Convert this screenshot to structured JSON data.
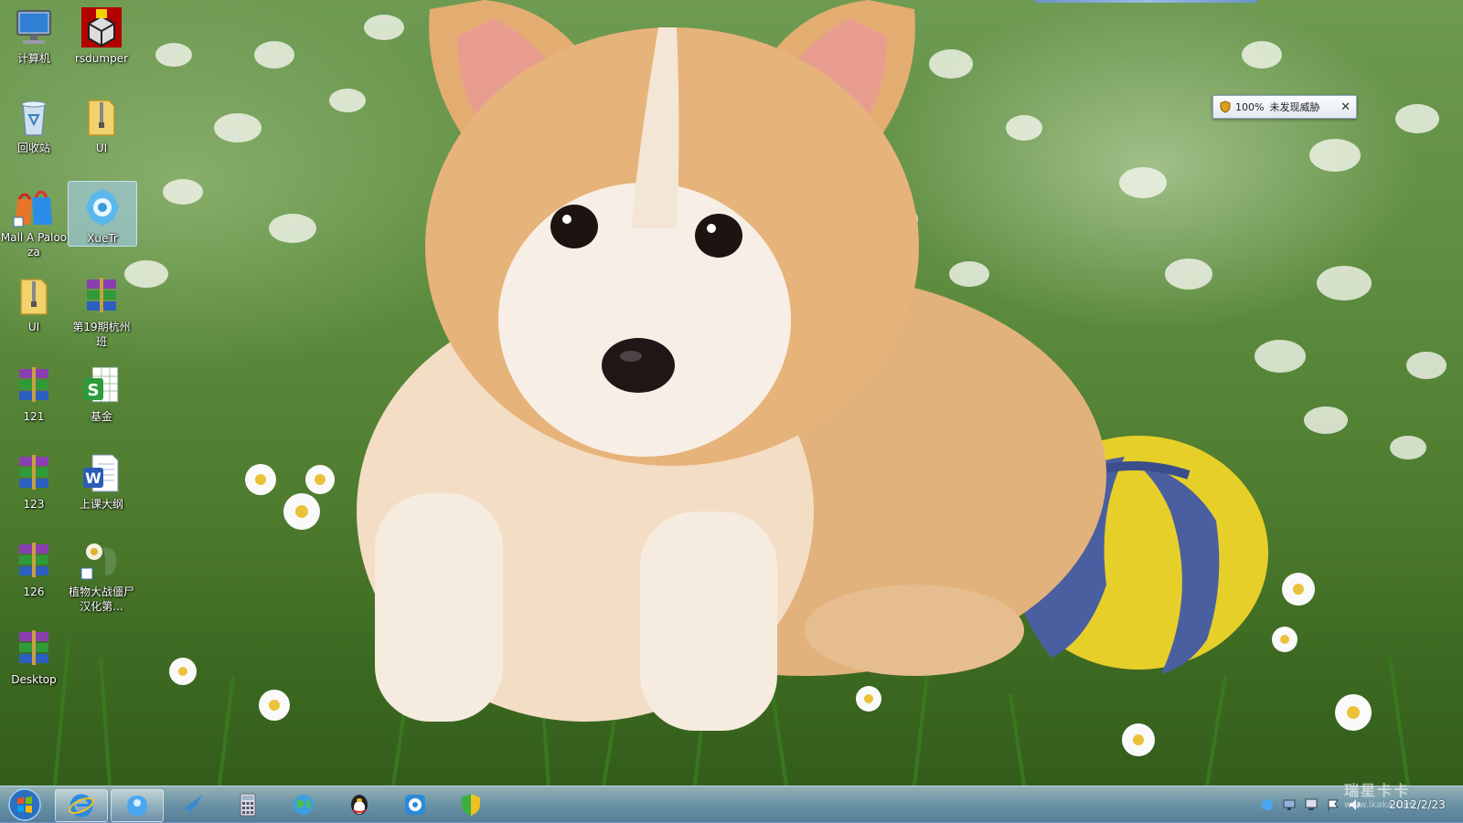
{
  "desktop": {
    "icons": [
      {
        "label": "计算机",
        "icon": "computer-icon"
      },
      {
        "label": "rsdumper",
        "icon": "rsdumper-icon"
      },
      {
        "label": "回收站",
        "icon": "recycle-bin-icon"
      },
      {
        "label": "UI",
        "icon": "zip-folder-icon"
      },
      {
        "label": "Mall A Palooza",
        "icon": "shopping-bag-icon"
      },
      {
        "label": "XueTr",
        "icon": "gear-icon"
      },
      {
        "label": "UI",
        "icon": "zip-folder-icon"
      },
      {
        "label": "第19期杭州班",
        "icon": "winrar-archive-icon"
      },
      {
        "label": "121",
        "icon": "winrar-archive-icon"
      },
      {
        "label": "基金",
        "icon": "spreadsheet-icon"
      },
      {
        "label": "123",
        "icon": "winrar-archive-icon"
      },
      {
        "label": "上课大纲",
        "icon": "word-document-icon"
      },
      {
        "label": "126",
        "icon": "winrar-archive-icon"
      },
      {
        "label": "植物大战僵尸 汉化第...",
        "icon": "plants-vs-zombies-icon"
      },
      {
        "label": "Desktop",
        "icon": "winrar-archive-icon"
      }
    ],
    "selected_label": "XueTr"
  },
  "antivirus_popup": {
    "percent": "100%",
    "status": "未发现威胁",
    "close": "✕",
    "icon": "shield-icon"
  },
  "taskbar": {
    "start_icon": "windows-logo-icon",
    "pinned": [
      "internet-explorer-icon",
      "qq-penguin-bubble-icon",
      "bird-icon",
      "calculator-icon",
      "globe-icon",
      "qq-icon",
      "qq-player-icon",
      "security-shield-icon"
    ],
    "tray_icons": [
      "qq-tray-icon",
      "network-icon",
      "display-icon",
      "flag-icon",
      "volume-icon"
    ],
    "clock_date": "2012/2/23"
  },
  "watermark": {
    "text": "瑞星卡卡",
    "url": "www.ikaka.com"
  },
  "colors": {
    "taskbar": "#7aa0c8",
    "selection": "#aad2fa",
    "grass": "#4f7d2f"
  }
}
